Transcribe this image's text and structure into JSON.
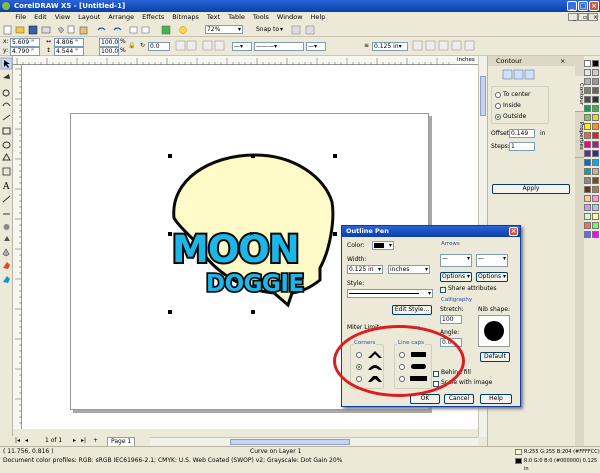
{
  "window": {
    "title": "CorelDRAW X5 - [Untitled-1]"
  },
  "menu": [
    "File",
    "Edit",
    "View",
    "Layout",
    "Arrange",
    "Effects",
    "Bitmaps",
    "Text",
    "Table",
    "Tools",
    "Window",
    "Help"
  ],
  "standard_toolbar": {
    "zoom": "72%",
    "snap_label": "Snap to"
  },
  "property_bar": {
    "x": "5.609 \"",
    "y": "4.790 \"",
    "w": "4.806 \"",
    "h": "4.544 \"",
    "sx": "100.0",
    "sy": "100.0",
    "pct": "%",
    "angle": "0.0",
    "outline_width": "0.125 in",
    "units_label": "inches"
  },
  "docker": {
    "tab_title": "Contour",
    "options": [
      "To center",
      "Inside",
      "Outside"
    ],
    "selected_option": "Outside",
    "offset_label": "Offset:",
    "offset_value": "0.149",
    "offset_unit": "in",
    "steps_label": "Steps:",
    "steps_value": "1",
    "apply_label": "Apply",
    "side_tabs": [
      "Contour",
      "Properties"
    ]
  },
  "artwork": {
    "line1": "MOON",
    "line2": "DOGGIE",
    "fill_color": "#fefbc8",
    "text_color": "#1cb6e8",
    "outline_color": "#0a0a0a"
  },
  "dialog": {
    "title": "Outline Pen",
    "color_label": "Color:",
    "width_label": "Width:",
    "width_value": "0.125 in",
    "width_units": "inches",
    "style_label": "Style:",
    "edit_style_label": "Edit Style...",
    "miter_label": "Miter Limit:",
    "corners_label": "Corners",
    "line_caps_label": "Line caps",
    "arrows_label": "Arrows",
    "options_left": "Options",
    "options_right": "Options",
    "share_attributes": "Share attributes",
    "calligraphy_label": "Calligraphy",
    "stretch_label": "Stretch:",
    "stretch_value": "100",
    "nib_label": "Nib shape:",
    "angle_label": "Angle:",
    "angle_value": "0.0",
    "default_label": "Default",
    "behind_fill": "Behind fill",
    "scale_with_image": "Scale with image",
    "ok_label": "OK",
    "cancel_label": "Cancel",
    "help_label": "Help"
  },
  "page_nav": {
    "count": "1 of 1",
    "page_tab": "Page 1"
  },
  "status": {
    "coords": "( 11.756, 0.816 )",
    "object_info": "Curve on Layer 1",
    "profiles": "Document color profiles: RGB: sRGB IEC61966-2.1; CMYK: U.S. Web Coated (SWOP) v2; Grayscale: Dot Gain 20%",
    "fill_info": "R:255 G:255 B:204 (#FFFFCC)",
    "outline_info": "R:0 G:0 B:0 (#000000)  0.125 in"
  },
  "palette_colors": [
    "#ffffff",
    "#000000",
    "#e6e6e6",
    "#cccccc",
    "#b3b3b3",
    "#999999",
    "#808080",
    "#666666",
    "#4d4d4d",
    "#333333",
    "#00a651",
    "#39b54a",
    "#8dc63f",
    "#d7df23",
    "#fff200",
    "#f7941d",
    "#f26522",
    "#ed1c24",
    "#ec008c",
    "#92278f",
    "#662d91",
    "#2e3192",
    "#0072bc",
    "#00aeef",
    "#00a99d",
    "#c7b299",
    "#998675",
    "#754c24",
    "#603913",
    "#a67c52",
    "#ffcc99",
    "#ff99cc",
    "#cc99ff",
    "#99ccff",
    "#ccffcc",
    "#ffff99",
    "#ff6666",
    "#66ff66",
    "#6666ff",
    "#ff00ff"
  ]
}
